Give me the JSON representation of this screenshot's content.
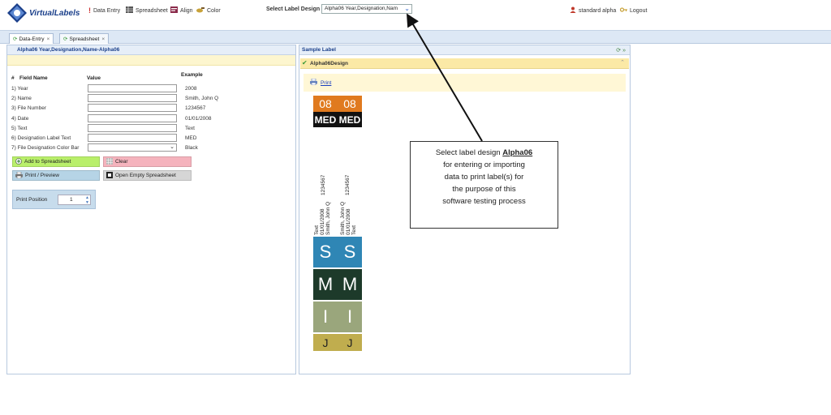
{
  "app": {
    "logo_text": "VirtualLabels"
  },
  "nav": {
    "data_entry": "Data Entry",
    "spreadsheet": "Spreadsheet",
    "align": "Align",
    "color": "Color"
  },
  "design": {
    "label": "Select Label Design",
    "selected": "Alpha06 Year,Designation,Nam"
  },
  "user": {
    "name": "standard alpha",
    "logout": "Logout"
  },
  "tabs": [
    {
      "label": "Data-Entry",
      "close": "×"
    },
    {
      "label": "Spreadsheet",
      "close": "×"
    }
  ],
  "left_panel": {
    "title": "Alpha06 Year,Designation,Name-Alpha06",
    "col_num": "#",
    "col_field": "Field Name",
    "col_value": "Value",
    "col_example": "Example",
    "fields": [
      {
        "label": "1) Year",
        "example": "2008"
      },
      {
        "label": "2) Name",
        "example": "Smith, John Q"
      },
      {
        "label": "3) File Number",
        "example": "1234567"
      },
      {
        "label": "4) Date",
        "example": "01/01/2008"
      },
      {
        "label": "5) Text",
        "example": "Text"
      },
      {
        "label": "6) Designation Label Text",
        "example": "MED"
      },
      {
        "label": "7) File Designation Color Bar",
        "example": "Black"
      }
    ],
    "buttons": {
      "add": "Add to Spreadsheet",
      "clear": "Clear",
      "print": "Print / Preview",
      "open_empty": "Open Empty Spreadsheet"
    },
    "print_position": {
      "label": "Print Position",
      "value": "1"
    }
  },
  "right_panel": {
    "title": "Sample Label",
    "design_name": "Alpha06Design",
    "print_link": "Print",
    "label": {
      "year_left": "08",
      "year_right": "08",
      "designation_left": "MED",
      "designation_right": "MED",
      "file_number": "1234567",
      "name": "Smith, John Q",
      "date": "01/01/2008",
      "text": "Text",
      "letters": [
        {
          "left": "S",
          "right": "S",
          "bg": "#2f86b5"
        },
        {
          "left": "M",
          "right": "M",
          "bg": "#1d3a2a"
        },
        {
          "left": "I",
          "right": "I",
          "bg": "#9aa67c"
        },
        {
          "left": "J",
          "right": "J",
          "bg": "#c0ad4e"
        }
      ]
    }
  },
  "callout": {
    "line1_pre": "Select label design ",
    "line1_bold": "Alpha06",
    "line2": "for entering or importing",
    "line3": "data to print label(s) for",
    "line4": "the purpose of this",
    "line5": "software testing process"
  },
  "colors": {
    "year_orange": "#e07a1f",
    "black": "#111111",
    "add_btn": "#b9ef6a",
    "clear_btn": "#f5b3bd",
    "print_btn": "#b6d4e6",
    "open_btn": "#d6d6d6"
  }
}
